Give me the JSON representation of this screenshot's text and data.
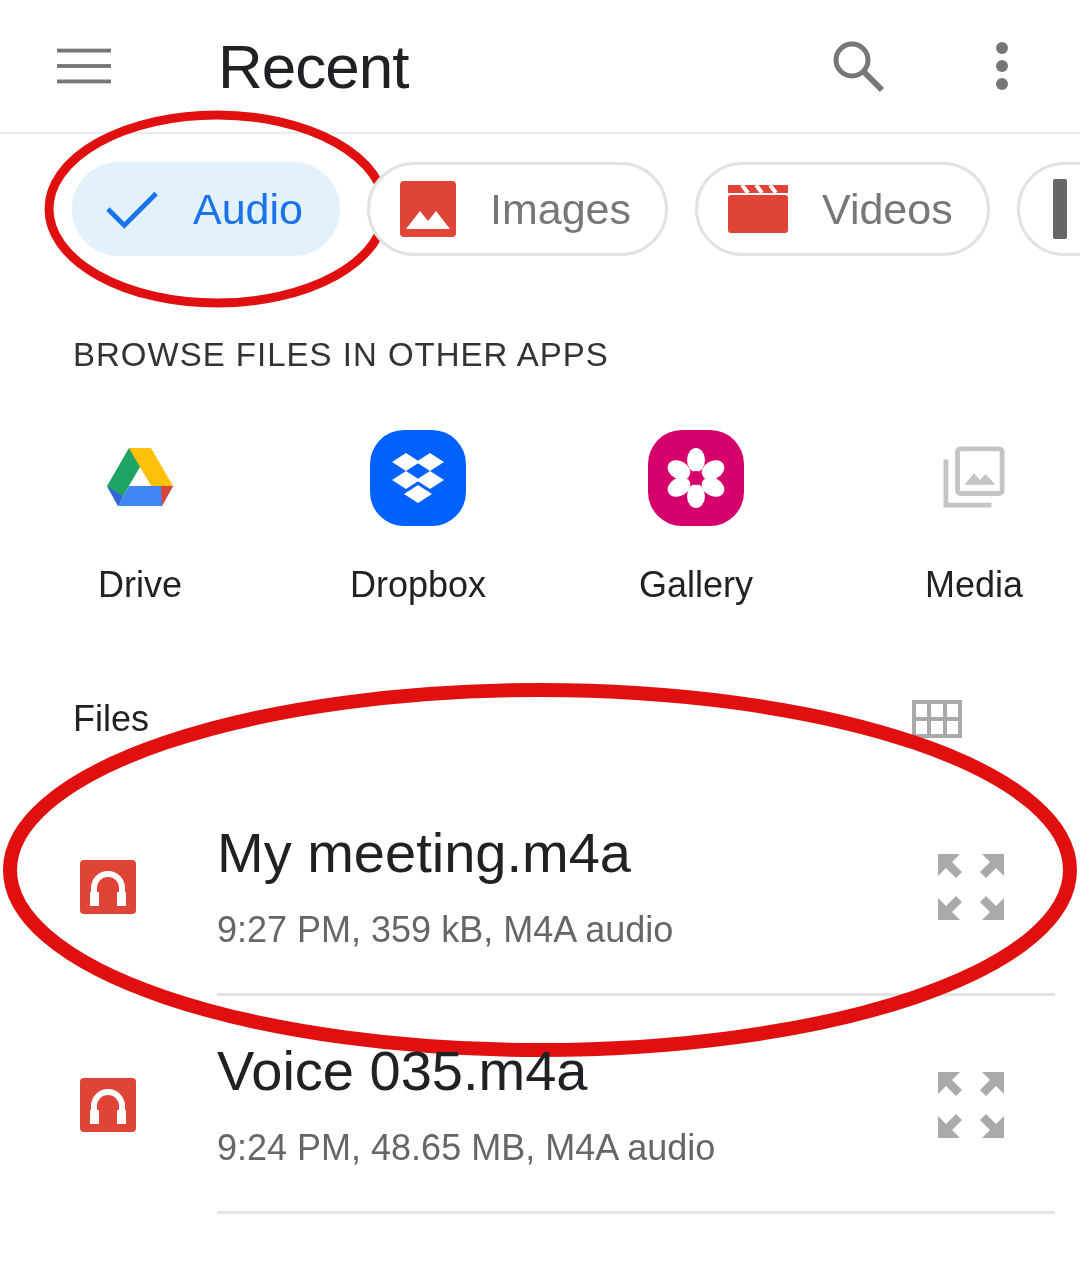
{
  "app_bar": {
    "title": "Recent"
  },
  "chips": [
    {
      "kind": "audio",
      "label": "Audio",
      "selected": true,
      "circled": true
    },
    {
      "kind": "images",
      "label": "Images",
      "selected": false,
      "circled": false
    },
    {
      "kind": "videos",
      "label": "Videos",
      "selected": false,
      "circled": false
    },
    {
      "kind": "documents",
      "selected": false,
      "circled": false
    }
  ],
  "browse": {
    "heading": "BROWSE FILES IN OTHER APPS",
    "apps": [
      {
        "kind": "drive",
        "label": "Drive"
      },
      {
        "kind": "dropbox",
        "label": "Dropbox"
      },
      {
        "kind": "gallery",
        "label": "Gallery"
      },
      {
        "kind": "media",
        "label": "Media"
      }
    ]
  },
  "files": {
    "heading": "Files",
    "items": [
      {
        "name": "My meeting.m4a",
        "details": "9:27 PM, 359 kB, M4A audio",
        "circled": true
      },
      {
        "name": "Voice 035.m4a",
        "details": "9:24 PM, 48.65 MB, M4A audio",
        "circled": false
      }
    ]
  }
}
